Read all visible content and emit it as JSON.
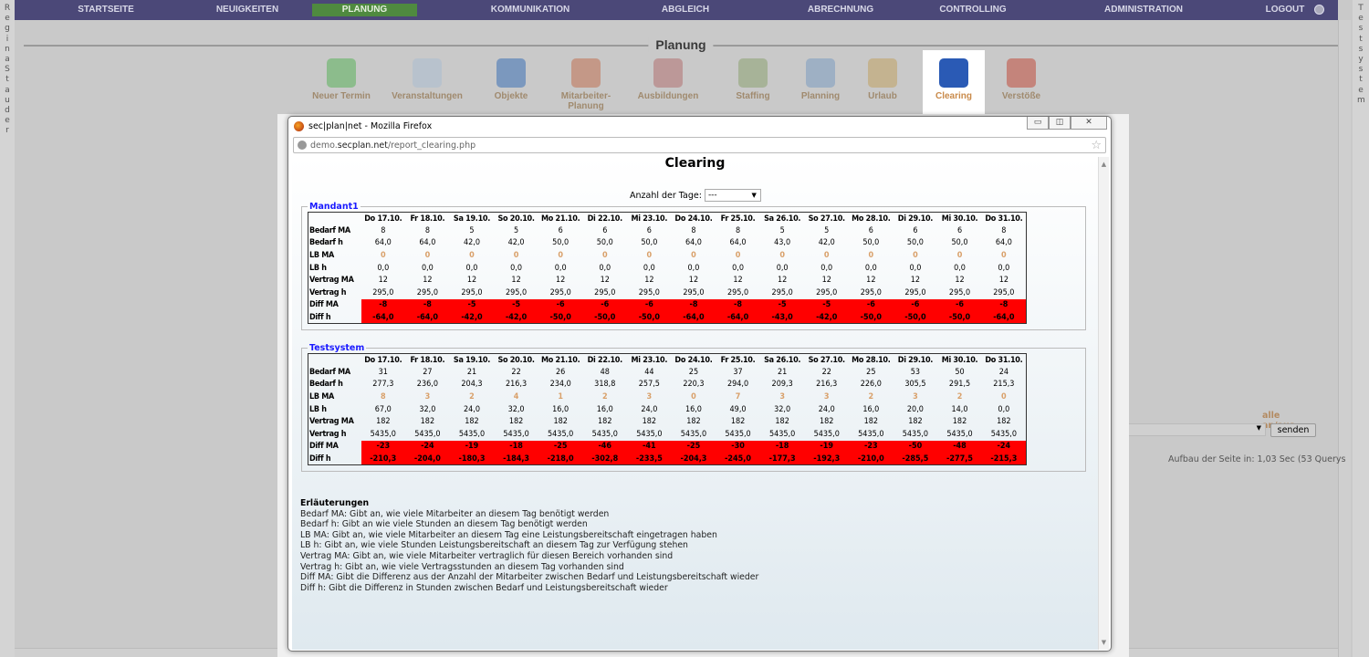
{
  "nav": {
    "items": [
      "STARTSEITE",
      "NEUIGKEITEN",
      "PLANUNG",
      "KOMMUNIKATION",
      "ABGLEICH",
      "ABRECHNUNG",
      "CONTROLLING",
      "ADMINISTRATION",
      "LOGOUT"
    ],
    "active": "PLANUNG"
  },
  "left_user": "Regina Stauder",
  "right_system": "Testsystem",
  "section_title": "Planung",
  "tools": [
    {
      "label": "Neuer Termin",
      "icon": "plus-icon",
      "color": "#5ab05a"
    },
    {
      "label": "Veranstaltungen",
      "icon": "diagram-icon",
      "color": "#a9bccf"
    },
    {
      "label": "Objekte",
      "icon": "cube-icon",
      "color": "#3a6fb5"
    },
    {
      "label": "Mitarbeiter-Planung",
      "icon": "people-icon",
      "color": "#c07050"
    },
    {
      "label": "Ausbildungen",
      "icon": "book-icon",
      "color": "#b07070"
    },
    {
      "label": "Staffing",
      "icon": "staffing-icon",
      "color": "#8aa070"
    },
    {
      "label": "Planning",
      "icon": "calendar-icon",
      "color": "#7a9ac0"
    },
    {
      "label": "Urlaub",
      "icon": "gantt-icon",
      "color": "#c0a060"
    },
    {
      "label": "Clearing",
      "icon": "clearing-icon",
      "color": "#2a5ab5",
      "selected": true
    },
    {
      "label": "Verstöße",
      "icon": "violation-icon",
      "color": "#c04a3a"
    }
  ],
  "window": {
    "title": "sec|plan|net - Mozilla Firefox",
    "url_pre": "demo.",
    "url_host": "secplan.net",
    "url_path": "/report_clearing.php",
    "btn_min": "▭",
    "btn_max": "◫",
    "btn_close": "✕"
  },
  "page": {
    "title": "Clearing",
    "days_label": "Anzahl der Tage:",
    "days_value": "---"
  },
  "days": [
    "Do 17.10.",
    "Fr 18.10.",
    "Sa 19.10.",
    "So 20.10.",
    "Mo 21.10.",
    "Di 22.10.",
    "Mi 23.10.",
    "Do 24.10.",
    "Fr 25.10.",
    "Sa 26.10.",
    "So 27.10.",
    "Mo 28.10.",
    "Di 29.10.",
    "Mi 30.10.",
    "Do 31.10."
  ],
  "row_labels": [
    "Bedarf MA",
    "Bedarf h",
    "LB MA",
    "LB h",
    "Vertrag MA",
    "Vertrag h",
    "Diff MA",
    "Diff h"
  ],
  "groups": [
    {
      "name": "Mandant1",
      "rows": [
        [
          "8",
          "8",
          "5",
          "5",
          "6",
          "6",
          "6",
          "8",
          "8",
          "5",
          "5",
          "6",
          "6",
          "6",
          "8"
        ],
        [
          "64,0",
          "64,0",
          "42,0",
          "42,0",
          "50,0",
          "50,0",
          "50,0",
          "64,0",
          "64,0",
          "43,0",
          "42,0",
          "50,0",
          "50,0",
          "50,0",
          "64,0"
        ],
        [
          "0",
          "0",
          "0",
          "0",
          "0",
          "0",
          "0",
          "0",
          "0",
          "0",
          "0",
          "0",
          "0",
          "0",
          "0"
        ],
        [
          "0,0",
          "0,0",
          "0,0",
          "0,0",
          "0,0",
          "0,0",
          "0,0",
          "0,0",
          "0,0",
          "0,0",
          "0,0",
          "0,0",
          "0,0",
          "0,0",
          "0,0"
        ],
        [
          "12",
          "12",
          "12",
          "12",
          "12",
          "12",
          "12",
          "12",
          "12",
          "12",
          "12",
          "12",
          "12",
          "12",
          "12"
        ],
        [
          "295,0",
          "295,0",
          "295,0",
          "295,0",
          "295,0",
          "295,0",
          "295,0",
          "295,0",
          "295,0",
          "295,0",
          "295,0",
          "295,0",
          "295,0",
          "295,0",
          "295,0"
        ],
        [
          "-8",
          "-8",
          "-5",
          "-5",
          "-6",
          "-6",
          "-6",
          "-8",
          "-8",
          "-5",
          "-5",
          "-6",
          "-6",
          "-6",
          "-8"
        ],
        [
          "-64,0",
          "-64,0",
          "-42,0",
          "-42,0",
          "-50,0",
          "-50,0",
          "-50,0",
          "-64,0",
          "-64,0",
          "-43,0",
          "-42,0",
          "-50,0",
          "-50,0",
          "-50,0",
          "-64,0"
        ]
      ]
    },
    {
      "name": "Testsystem",
      "rows": [
        [
          "31",
          "27",
          "21",
          "22",
          "26",
          "48",
          "44",
          "25",
          "37",
          "21",
          "22",
          "25",
          "53",
          "50",
          "24"
        ],
        [
          "277,3",
          "236,0",
          "204,3",
          "216,3",
          "234,0",
          "318,8",
          "257,5",
          "220,3",
          "294,0",
          "209,3",
          "216,3",
          "226,0",
          "305,5",
          "291,5",
          "215,3"
        ],
        [
          "8",
          "3",
          "2",
          "4",
          "1",
          "2",
          "3",
          "0",
          "7",
          "3",
          "3",
          "2",
          "3",
          "2",
          "0"
        ],
        [
          "67,0",
          "32,0",
          "24,0",
          "32,0",
          "16,0",
          "16,0",
          "24,0",
          "16,0",
          "49,0",
          "32,0",
          "24,0",
          "16,0",
          "20,0",
          "14,0",
          "0,0"
        ],
        [
          "182",
          "182",
          "182",
          "182",
          "182",
          "182",
          "182",
          "182",
          "182",
          "182",
          "182",
          "182",
          "182",
          "182",
          "182"
        ],
        [
          "5435,0",
          "5435,0",
          "5435,0",
          "5435,0",
          "5435,0",
          "5435,0",
          "5435,0",
          "5435,0",
          "5435,0",
          "5435,0",
          "5435,0",
          "5435,0",
          "5435,0",
          "5435,0",
          "5435,0"
        ],
        [
          "-23",
          "-24",
          "-19",
          "-18",
          "-25",
          "-46",
          "-41",
          "-25",
          "-30",
          "-18",
          "-19",
          "-23",
          "-50",
          "-48",
          "-24"
        ],
        [
          "-210,3",
          "-204,0",
          "-180,3",
          "-184,3",
          "-218,0",
          "-302,8",
          "-233,5",
          "-204,3",
          "-245,0",
          "-177,3",
          "-192,3",
          "-210,0",
          "-285,5",
          "-277,5",
          "-215,3"
        ]
      ]
    }
  ],
  "explanations": {
    "heading": "Erläuterungen",
    "lines": [
      "Bedarf MA: Gibt an, wie viele Mitarbeiter an diesem Tag benötigt werden",
      "Bedarf h: Gibt an wie viele Stunden an diesem Tag benötigt werden",
      "LB MA: Gibt an, wie viele Mitarbeiter an diesem Tag eine Leistungsbereitschaft eingetragen haben",
      "LB h: Gibt an, wie viele Stunden Leistungsbereitschaft an diesem Tag zur Verfügung stehen",
      "Vertrag MA: Gibt an, wie viele Mitarbeiter vertraglich für diesen Bereich vorhanden sind",
      "Vertrag h: Gibt an, wie viele Vertragsstunden an diesem Tag vorhanden sind",
      "Diff MA: Gibt die Differenz aus der Anzahl der Mitarbeiter zwischen Bedarf und Leistungsbereitschaft wieder",
      "Diff h: Gibt die Differenz in Stunden zwischen Bedarf und Leistungsbereitschaft wieder"
    ]
  },
  "background": {
    "toggle_all": "alle an/aus",
    "select_value": "ken",
    "send": "senden",
    "build_time": "Aufbau der Seite in: 1,03 Sec (53 Querys"
  },
  "colors": {
    "nav": "#4b4878",
    "active": "#4f8a3f",
    "diff": "#ff0000",
    "lb": "#d9a06a",
    "legend": "#1a1aff"
  }
}
